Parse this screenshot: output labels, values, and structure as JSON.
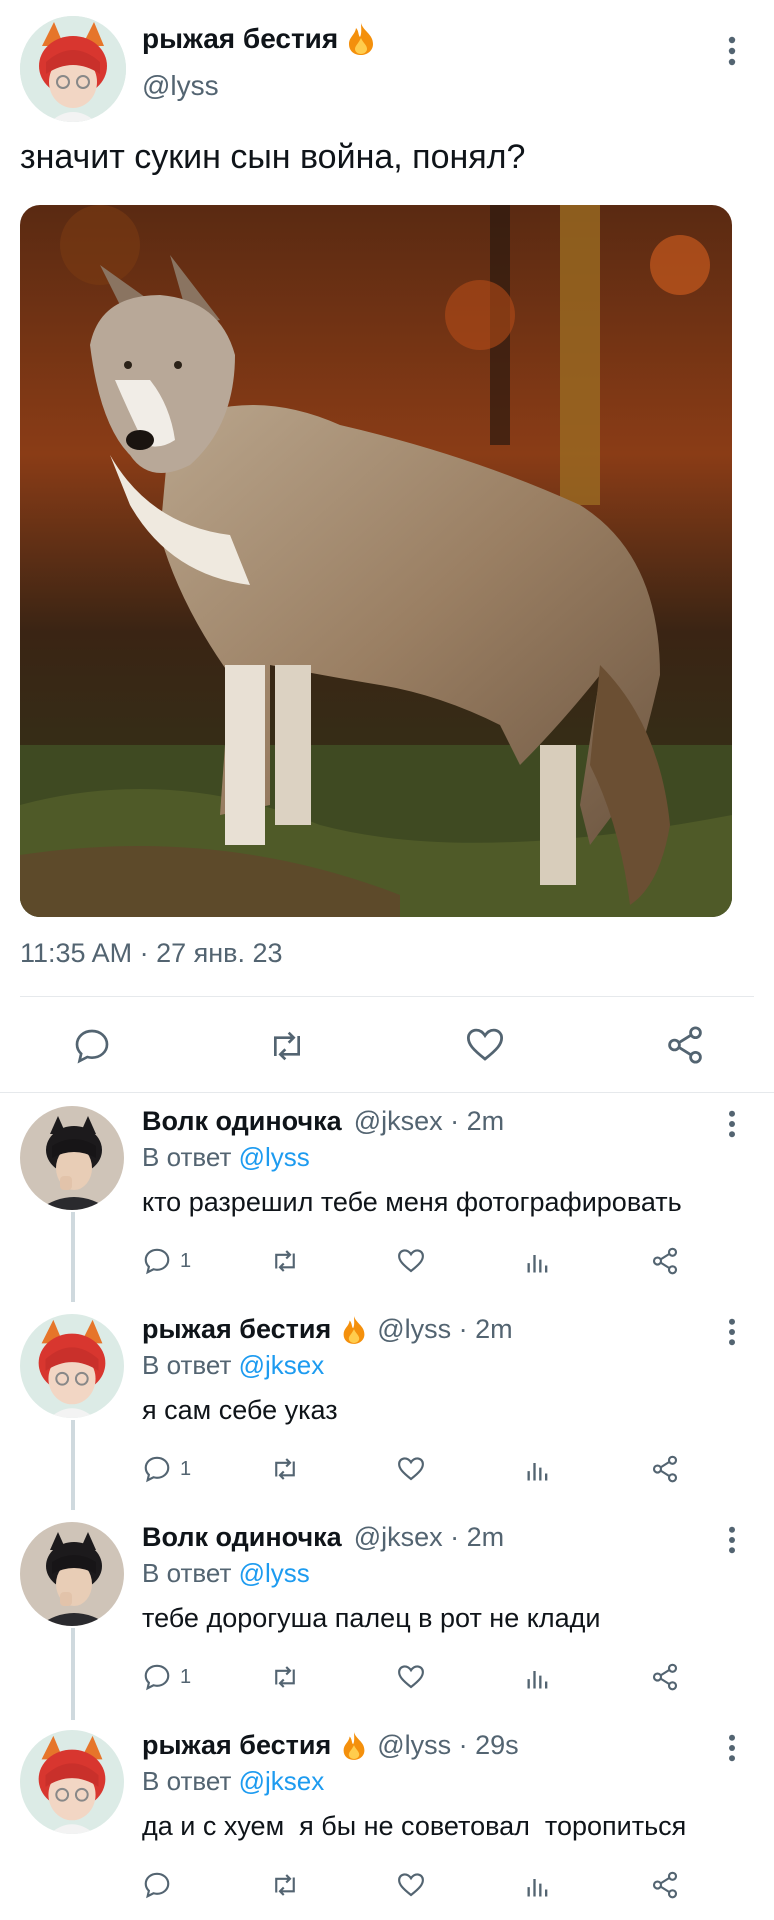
{
  "main_tweet": {
    "author_name": "рыжая бестия",
    "author_handle": "@lyss",
    "text": "значит сукин сын война,  понял?",
    "timestamp": "11:35 AM · 27 янв. 23",
    "actions": [
      "reply",
      "retweet",
      "like",
      "share"
    ]
  },
  "replies": [
    {
      "author_name": "Волк одиночка",
      "meta": "@jksex · 2m",
      "reply_prefix": "В ответ",
      "reply_to": "@lyss",
      "text": "кто разрешил тебе меня фотографировать",
      "reply_count": "1"
    },
    {
      "author_name": "рыжая бестия",
      "meta": "@lyss · 2m",
      "reply_prefix": "В ответ",
      "reply_to": "@jksex",
      "text": "я сам себе указ",
      "reply_count": "1"
    },
    {
      "author_name": "Волк одиночка",
      "meta": "@jksex · 2m",
      "reply_prefix": "В ответ",
      "reply_to": "@lyss",
      "text": "тебе дорогуша палец в рот не клади",
      "reply_count": "1"
    },
    {
      "author_name": "рыжая бестия",
      "meta": "@lyss · 29s",
      "reply_prefix": "В ответ",
      "reply_to": "@jksex",
      "text": "да и с хуем  я бы не советовал  торопиться",
      "reply_count": ""
    }
  ],
  "colors": {
    "accent": "#1d9bf0",
    "muted": "#536471",
    "fire": "#f4900c"
  },
  "icons": [
    "fire-icon",
    "more-vertical-icon",
    "reply-icon",
    "retweet-icon",
    "like-icon",
    "share-icon",
    "views-icon"
  ]
}
